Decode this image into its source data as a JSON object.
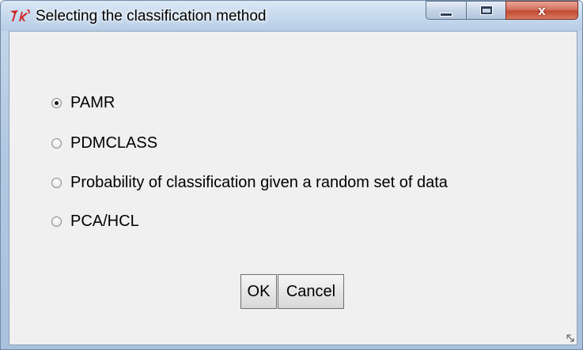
{
  "window": {
    "title": "Selecting the classification method",
    "app_icon": "tk-feather-icon",
    "caption_buttons": {
      "minimize": "minimize-icon",
      "maximize": "maximize-icon",
      "close_glyph": "x"
    }
  },
  "options": {
    "items": [
      {
        "label": "PAMR",
        "selected": true
      },
      {
        "label": "PDMCLASS",
        "selected": false
      },
      {
        "label": "Probability of classification given a random set of data",
        "selected": false
      },
      {
        "label": "PCA/HCL",
        "selected": false
      }
    ]
  },
  "buttons": {
    "ok_label": "OK",
    "cancel_label": "Cancel"
  },
  "colors": {
    "title_bar": "#c9dbee",
    "client_background": "#f0f0f0",
    "close_button": "#c24a33",
    "app_icon_red": "#d02020"
  }
}
